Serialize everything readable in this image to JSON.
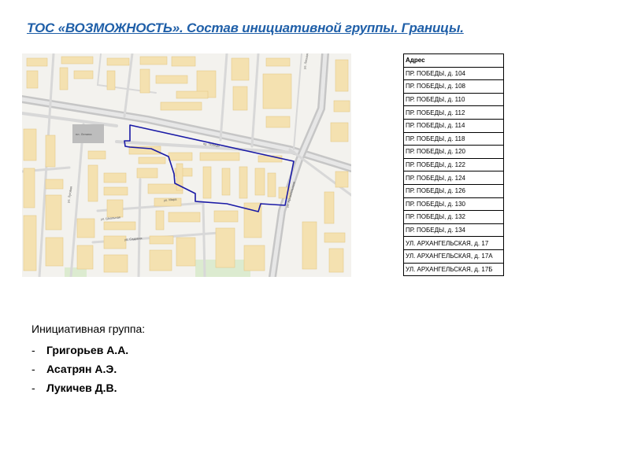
{
  "title": "ТОС «ВОЗМОЖНОСТЬ». Состав  инициативной  группы. Границы.",
  "map": {
    "icon": "map-image",
    "colors": {
      "background": "#f3f2ee",
      "building": "#f4e1b0",
      "road": "#d4d4d4",
      "highway": "#c4c4c4",
      "boundary": "#1a1aa6",
      "green": "#dcebd0",
      "square": "#bdbdbd"
    },
    "labels": {
      "square": "пл. Ленина",
      "avenue": "пр. Победы",
      "street_vert": "ул. Архангельская",
      "street_1": "ул. Луговая",
      "street_2": "ул. Школьная",
      "street_3": "ул. Мира",
      "street_4": "ул. Садовая",
      "street_5": "ул. Лесная"
    }
  },
  "table": {
    "header": "Адрес",
    "rows": [
      "ПР. ПОБЕДЫ, д. 104",
      "ПР. ПОБЕДЫ, д. 108",
      "ПР. ПОБЕДЫ, д. 110",
      "ПР. ПОБЕДЫ, д. 112",
      "ПР. ПОБЕДЫ, д. 114",
      "ПР. ПОБЕДЫ, д. 118",
      "ПР. ПОБЕДЫ, д. 120",
      "ПР. ПОБЕДЫ, д. 122",
      "ПР. ПОБЕДЫ, д. 124",
      "ПР. ПОБЕДЫ, д. 126",
      "ПР. ПОБЕДЫ, д. 130",
      "ПР. ПОБЕДЫ, д. 132",
      "ПР. ПОБЕДЫ, д. 134",
      "УЛ. АРХАНГЕЛЬСКАЯ, д. 17",
      "УЛ. АРХАНГЕЛЬСКАЯ, д. 17А",
      "УЛ. АРХАНГЕЛЬСКАЯ, д. 17Б"
    ]
  },
  "group": {
    "heading": "Инициативная группа:",
    "bullet": "-",
    "members": [
      "Григорьев А.А.",
      "Асатрян А.Э.",
      "Лукичев Д.В."
    ]
  }
}
